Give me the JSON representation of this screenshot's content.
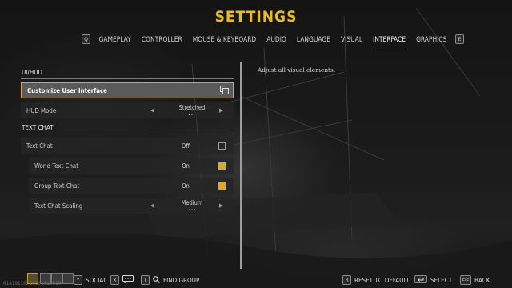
{
  "header": {
    "title": "SETTINGS",
    "left_key": "Q",
    "right_key": "E",
    "tabs": [
      "GAMEPLAY",
      "CONTROLLER",
      "MOUSE & KEYBOARD",
      "AUDIO",
      "LANGUAGE",
      "VISUAL",
      "INTERFACE",
      "GRAPHICS"
    ],
    "active_tab": "INTERFACE"
  },
  "sections": {
    "ui_hud": "UI/HUD",
    "text_chat": "TEXT CHAT"
  },
  "settings": {
    "customize_ui": {
      "label": "Customize User Interface"
    },
    "hud_mode": {
      "label": "HUD Mode",
      "value": "Stretched"
    },
    "text_chat": {
      "label": "Text Chat",
      "value": "Off",
      "checked": false
    },
    "world_text_chat": {
      "label": "World Text Chat",
      "value": "On",
      "checked": true
    },
    "group_text_chat": {
      "label": "Group Text Chat",
      "value": "On",
      "checked": true
    },
    "text_chat_scaling": {
      "label": "Text Chat Scaling",
      "value": "Medium"
    }
  },
  "description": "Adjust all visual elements.",
  "footer": {
    "social": {
      "key": "Y",
      "label": "SOCIAL"
    },
    "chat_key": "X",
    "find_group": {
      "key": "T",
      "label": "FIND GROUP"
    },
    "reset": {
      "key": "R",
      "label": "RESET TO DEFAULT"
    },
    "select": {
      "label": "SELECT"
    },
    "back": {
      "key": "Esc",
      "label": "BACK"
    },
    "serial": "01819110510101010010"
  },
  "colors": {
    "accent": "#e8b928",
    "selected_border": "#d9a92a",
    "panel_bg": "#262626"
  }
}
